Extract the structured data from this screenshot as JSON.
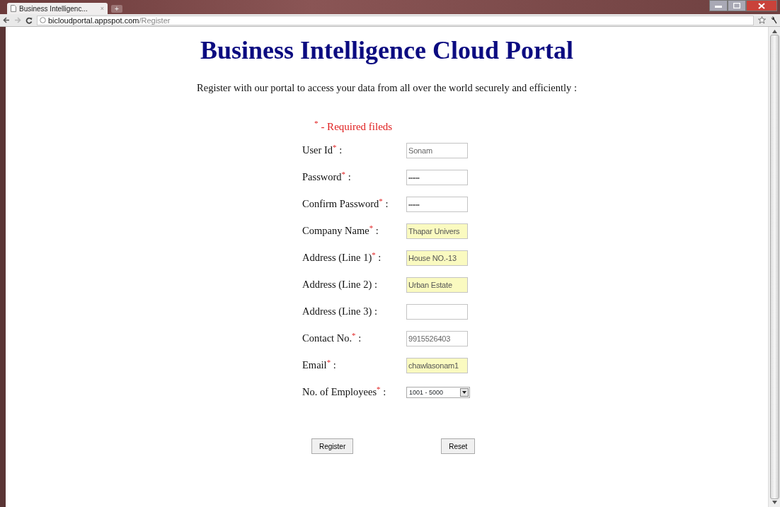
{
  "browser": {
    "tab_title": "Business Intelligenc...",
    "tab_close": "×",
    "new_tab": "+",
    "url_host": "bicloudportal.appspot.com",
    "url_path": "/Register"
  },
  "page": {
    "title": "Business Intelligence Cloud Portal",
    "intro": "Register with our portal to access your data from all over the world securely and efficiently :",
    "required_note": "$^{*}$ - Required fileds"
  },
  "fields": [
    {
      "label": "User Id$^{*}$ :",
      "kind": "text",
      "value": "Sonam",
      "autofilled": false
    },
    {
      "label": "Password$^{*}$ :",
      "kind": "password",
      "value": "••••••",
      "autofilled": false
    },
    {
      "label": "Confirm Password$^{*}$ :",
      "kind": "password",
      "value": "••••••",
      "autofilled": false
    },
    {
      "label": "Company Name$^{*}$ :",
      "kind": "text",
      "value": "Thapar Univers",
      "autofilled": true
    },
    {
      "label": "Address (Line 1)$^{*}$ :",
      "kind": "text",
      "value": "House NO.-13",
      "autofilled": true
    },
    {
      "label": "Address (Line 2) :",
      "kind": "text",
      "value": "Urban Estate",
      "autofilled": true
    },
    {
      "label": "Address (Line 3) :",
      "kind": "text",
      "autofilled": false
    },
    {
      "label": "Contact No.$^{*}$ :",
      "kind": "text",
      "value": "9915526403",
      "autofilled": false
    },
    {
      "label": "Email$^{*}$ :",
      "kind": "text",
      "value": "chawlasonam1",
      "autofilled": true
    },
    {
      "label": "No. of Employees$^{*}$ :",
      "kind": "select",
      "value": "1001 - 5000",
      "autofilled": false
    }
  ],
  "buttons": [
    "Register",
    "Reset"
  ]
}
